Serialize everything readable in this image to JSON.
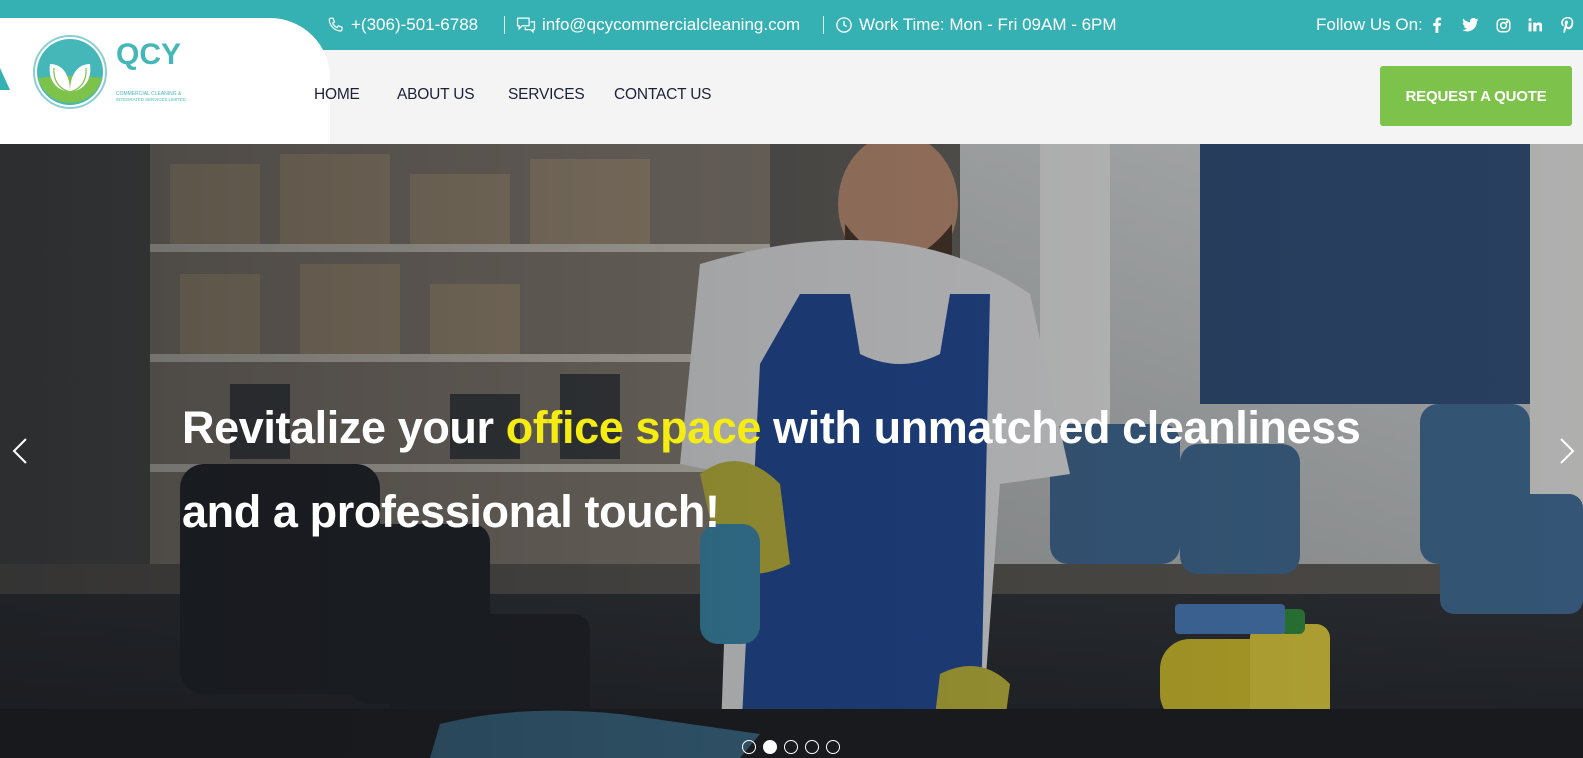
{
  "topbar": {
    "phone": "+(306)-501-6788",
    "email": "info@qcycommercialcleaning.com",
    "work_time": "Work Time: Mon - Fri 09AM - 6PM",
    "follow_label": "Follow Us On:",
    "social_icons": [
      "facebook-icon",
      "twitter-icon",
      "instagram-icon",
      "linkedin-icon",
      "pinterest-icon"
    ],
    "bg_color": "#35b1b3"
  },
  "logo": {
    "letters": "QCY",
    "tagline_1": "COMMERCIAL CLEANING &",
    "tagline_2": "INTEGRATED SERVICES LIMITED"
  },
  "nav": {
    "items": [
      {
        "label": "HOME"
      },
      {
        "label": "ABOUT US"
      },
      {
        "label": "SERVICES"
      },
      {
        "label": "CONTACT US"
      }
    ],
    "cta_label": "REQUEST A QUOTE",
    "cta_color": "#7dc24b"
  },
  "hero": {
    "headline_part1": "Revitalize your ",
    "headline_highlight": "office space",
    "headline_part2": " with unmatched cleanliness and a professional touch!",
    "highlight_color": "#f4ec12",
    "slide_count": 5,
    "active_slide": 2,
    "prev_icon": "chevron-left-icon",
    "next_icon": "chevron-right-icon"
  }
}
